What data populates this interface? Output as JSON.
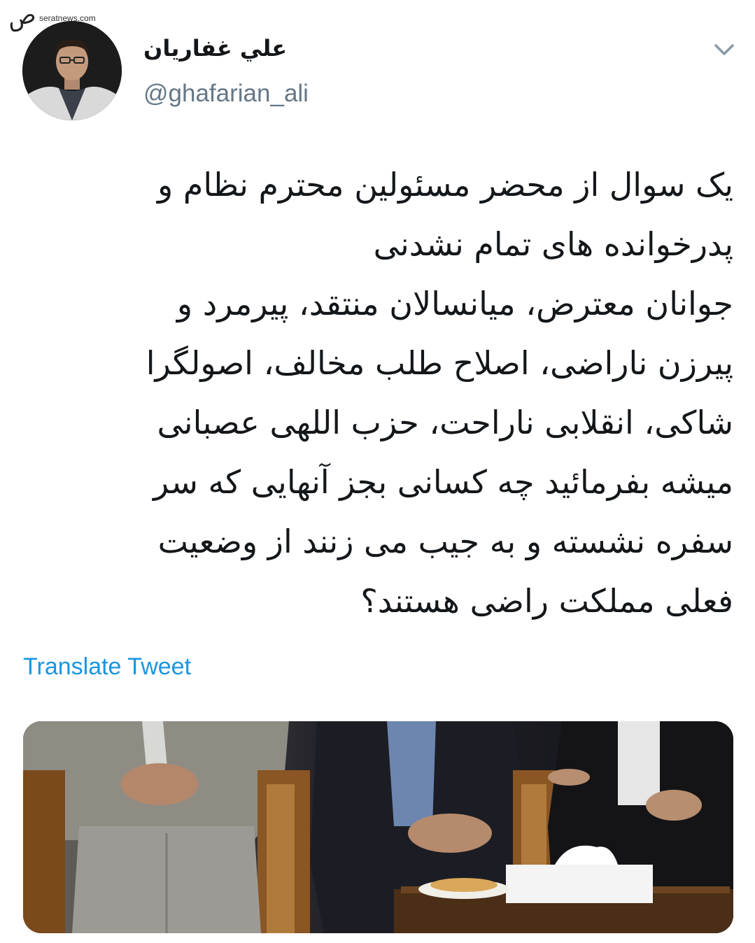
{
  "watermark": {
    "site": "seratnews.com",
    "logo_text": "صراط"
  },
  "tweet": {
    "author": {
      "display_name": "علي غفاريان",
      "handle": "@ghafarian_ali"
    },
    "text_lines": [
      "یک سوال از محضر مسئولین محترم نظام و",
      "پدرخوانده های تمام نشدنی",
      "جوانان معترض، میانسالان منتقد، پیرمرد و",
      "پیرزن ناراضی، اصلاح طلب مخالف، اصولگرا",
      "شاکی، انقلابی ناراحت، حزب اللهی عصبانی",
      "میشه بفرمائید چه کسانی بجز آنهایی که سر",
      "سفره نشسته و به جیب می زنند از وضعیت",
      "فعلی مملکت راضی هستند؟"
    ],
    "translate_label": "Translate Tweet",
    "menu_icon": "chevron-down-icon",
    "media_alt": "photo-seated-officials"
  },
  "colors": {
    "link": "#1b95e0",
    "handle": "#657786",
    "text": "#14171a"
  }
}
